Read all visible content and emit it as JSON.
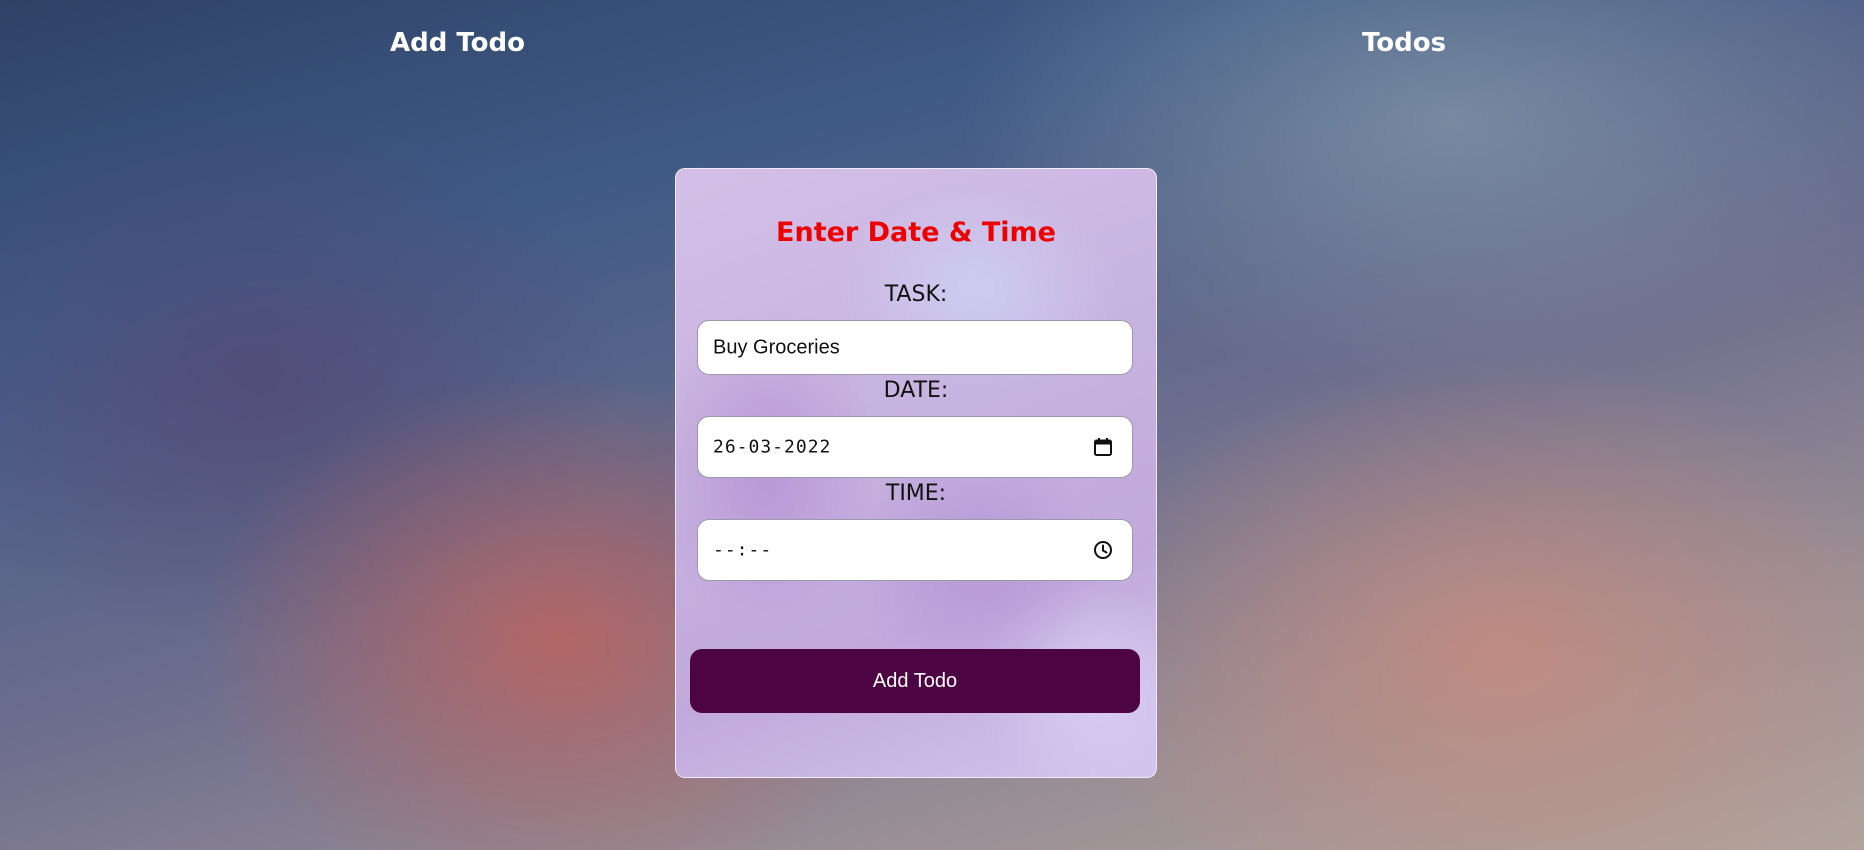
{
  "nav": {
    "add_todo": "Add Todo",
    "todos": "Todos"
  },
  "form": {
    "title": "Enter Date & Time",
    "task_label": "TASK:",
    "task_value": "Buy Groceries",
    "date_label": "DATE:",
    "date_value": "26-03-2022",
    "time_label": "TIME:",
    "time_value": "--:--",
    "submit_label": "Add Todo"
  },
  "icons": {
    "date_picker": "calendar-icon",
    "time_picker": "clock-icon"
  },
  "colors": {
    "title": "#ee0000",
    "button": "#4d0442",
    "nav_text": "#ffffff"
  }
}
